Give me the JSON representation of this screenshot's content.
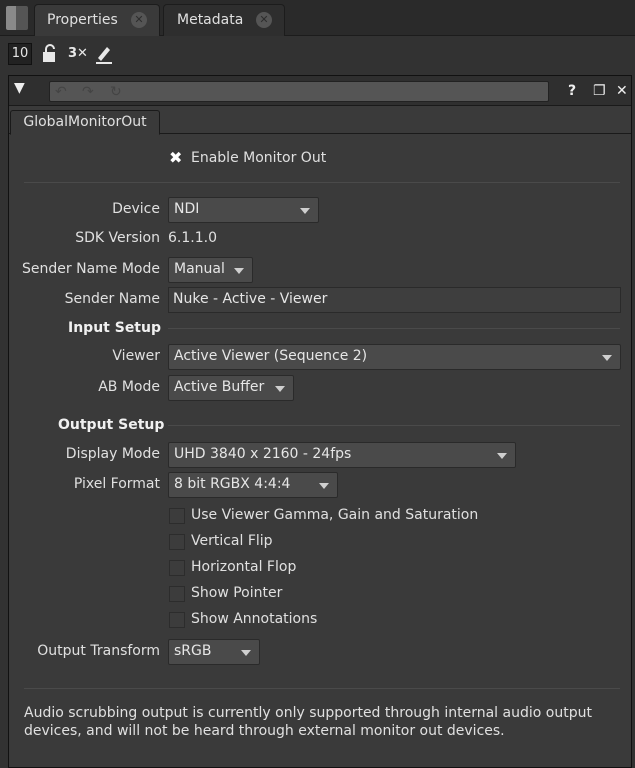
{
  "tabs": [
    {
      "label": "Properties"
    },
    {
      "label": "Metadata"
    }
  ],
  "toolbar": {
    "max_panels": "10"
  },
  "node": {
    "tab_label": "GlobalMonitorOut"
  },
  "enable_monitor_out": {
    "label": "Enable Monitor Out",
    "checked": true
  },
  "device": {
    "label": "Device",
    "value": "NDI"
  },
  "sdk_version": {
    "label": "SDK Version",
    "value": "6.1.1.0"
  },
  "sender_name_mode": {
    "label": "Sender Name Mode",
    "value": "Manual"
  },
  "sender_name": {
    "label": "Sender Name",
    "value": "Nuke - Active - Viewer"
  },
  "input_setup": {
    "title": "Input Setup"
  },
  "viewer": {
    "label": "Viewer",
    "value": "Active Viewer (Sequence 2)"
  },
  "ab_mode": {
    "label": "AB Mode",
    "value": "Active Buffer"
  },
  "output_setup": {
    "title": "Output Setup"
  },
  "display_mode": {
    "label": "Display Mode",
    "value": "UHD 3840 x 2160 - 24fps"
  },
  "pixel_format": {
    "label": "Pixel Format",
    "value": "8 bit RGBX 4:4:4"
  },
  "options": [
    {
      "label": "Use Viewer Gamma, Gain and Saturation",
      "checked": false
    },
    {
      "label": "Vertical Flip",
      "checked": false
    },
    {
      "label": "Horizontal Flop",
      "checked": false
    },
    {
      "label": "Show Pointer",
      "checked": false
    },
    {
      "label": "Show Annotations",
      "checked": false
    }
  ],
  "output_transform": {
    "label": "Output Transform",
    "value": "sRGB"
  },
  "note": "Audio scrubbing output is currently only supported through internal audio output devices, and will not be heard through external monitor out devices.",
  "icons": [
    "panel-grip-icon",
    "close-icon",
    "lock-icon",
    "disable-icon",
    "pencil-icon",
    "collapse-arrow-icon",
    "undo-icon",
    "redo-icon",
    "revert-icon",
    "help-icon",
    "float-icon",
    "close-panel-icon",
    "checkmark-x-icon"
  ]
}
